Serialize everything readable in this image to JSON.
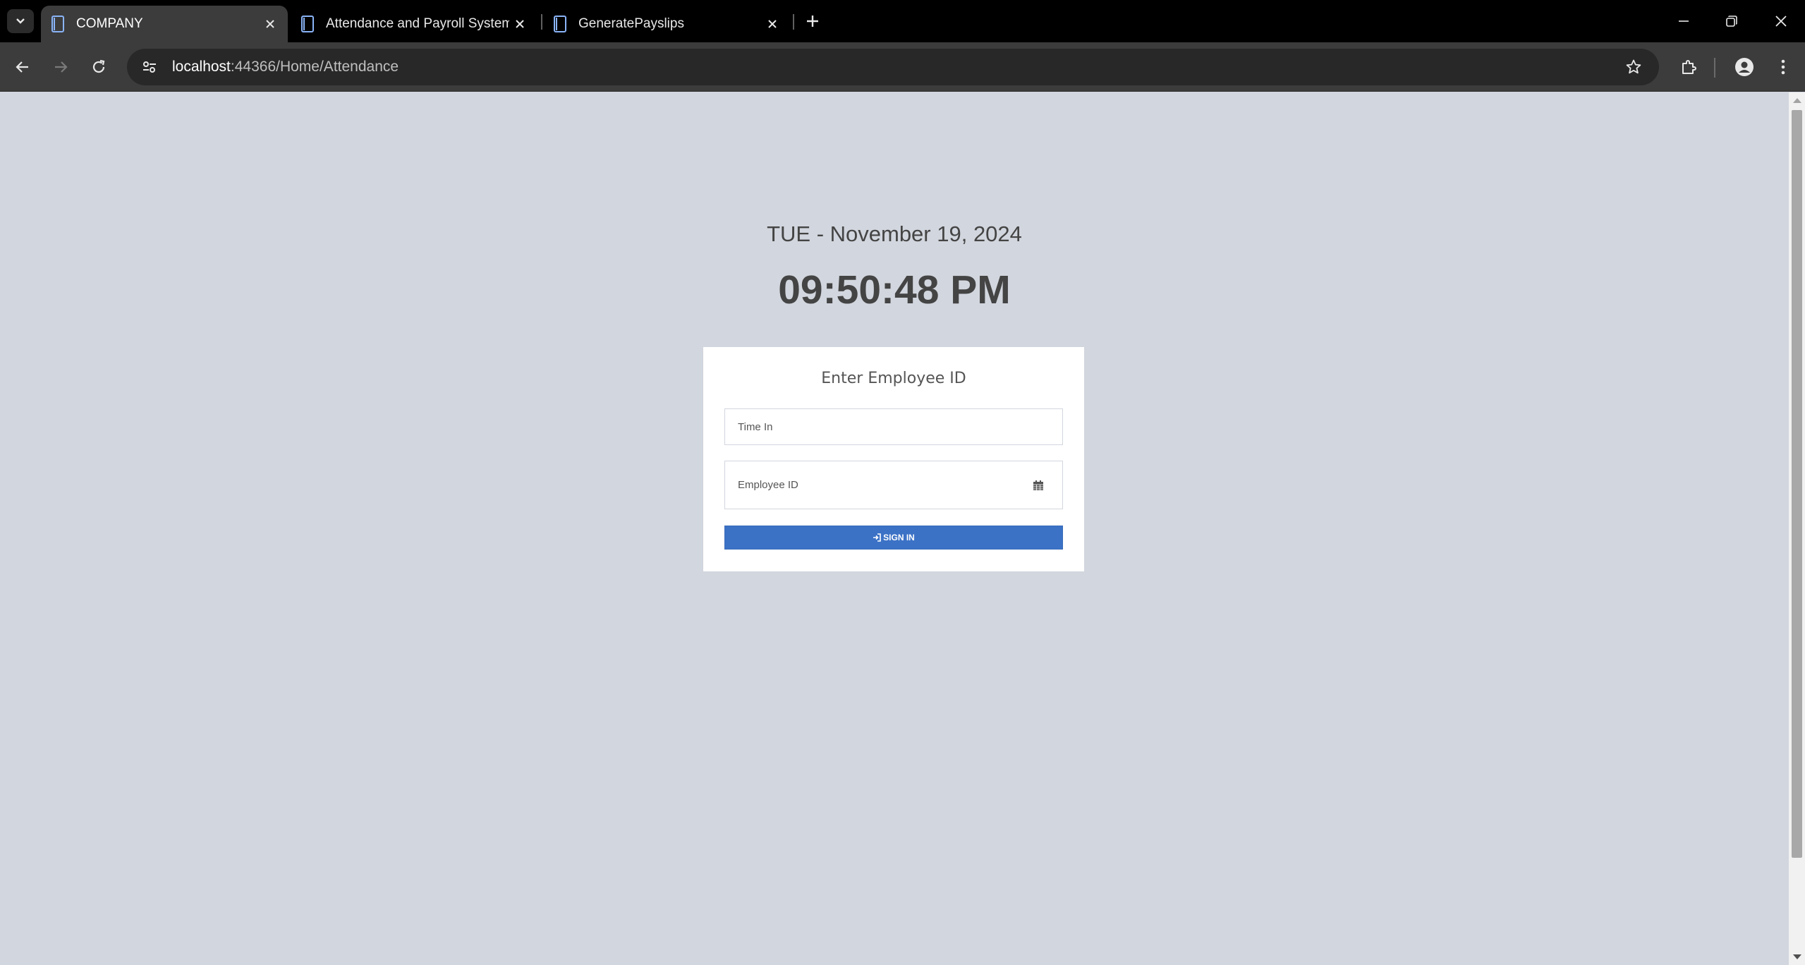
{
  "browser": {
    "tabs": [
      {
        "title": "COMPANY",
        "active": true
      },
      {
        "title": "Attendance and Payroll System",
        "active": false
      },
      {
        "title": "GeneratePayslips",
        "active": false
      }
    ],
    "url_host": "localhost",
    "url_path": ":44366/Home/Attendance"
  },
  "page": {
    "date": "TUE - November 19, 2024",
    "time": "09:50:48 PM",
    "card_heading": "Enter Employee ID",
    "mode_placeholder": "Time In",
    "employee_placeholder": "Employee ID",
    "signin_label": "SIGN IN"
  },
  "colors": {
    "page_bg": "#d2d6de",
    "button": "#3c72c6"
  }
}
